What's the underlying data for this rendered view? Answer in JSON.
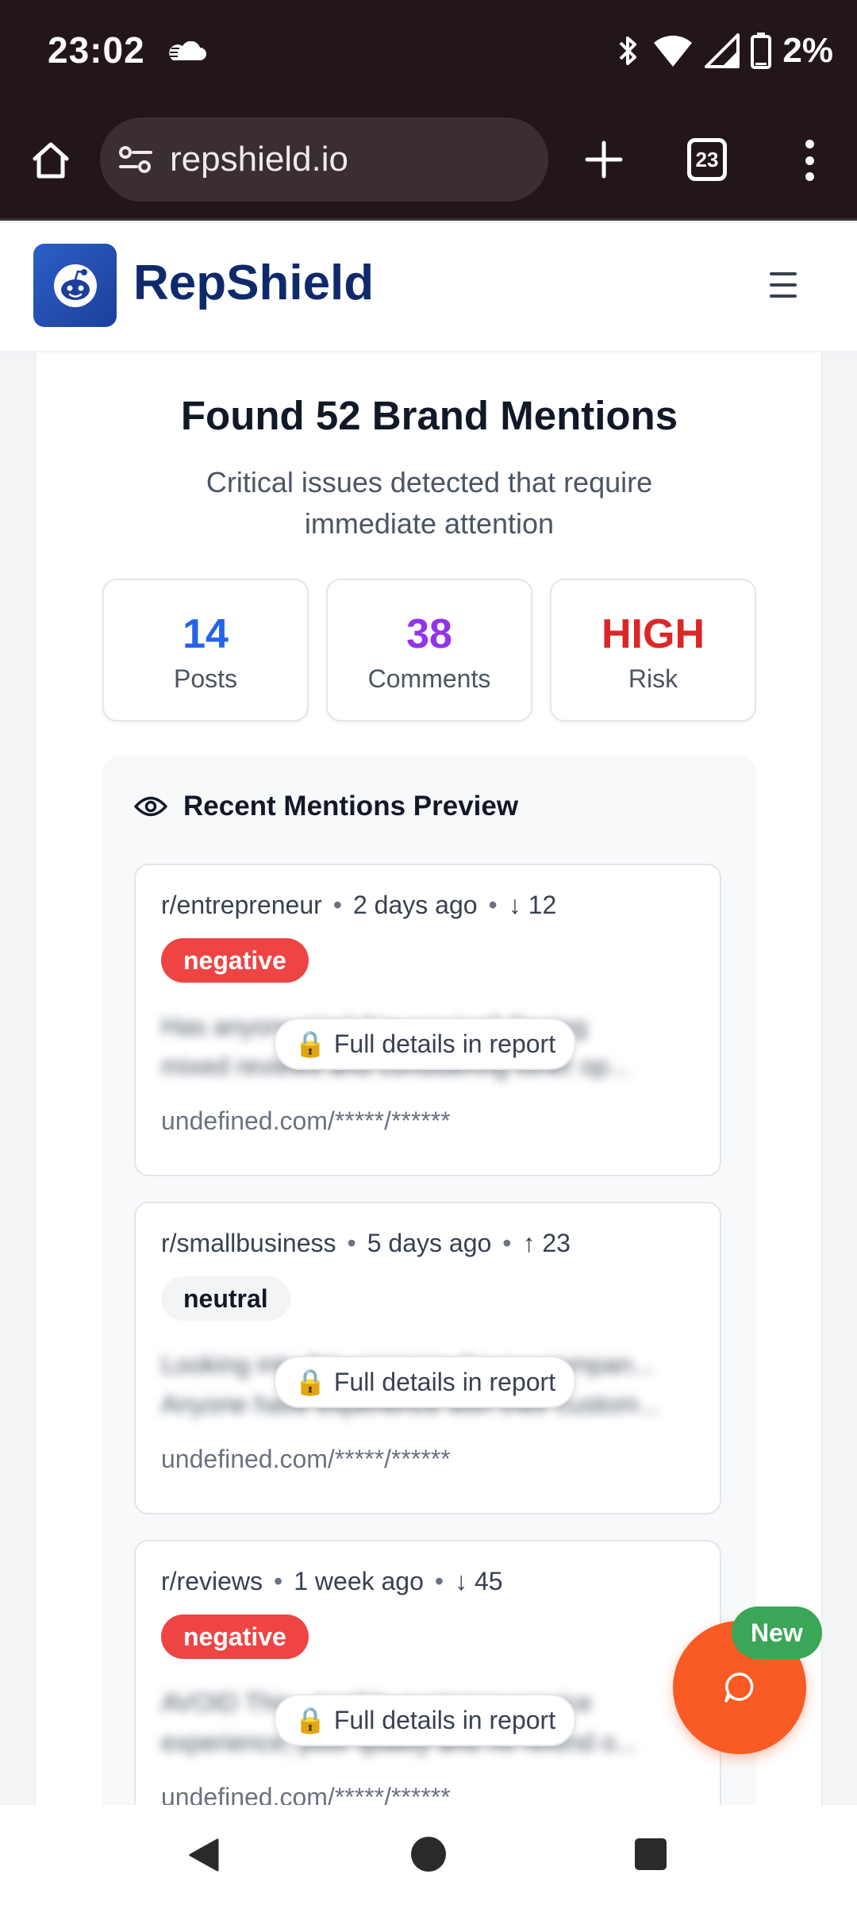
{
  "status_bar": {
    "time": "23:02",
    "battery": "2%",
    "icons": [
      "cloud-icon",
      "bluetooth-icon",
      "wifi-icon",
      "signal-icon",
      "battery-icon"
    ]
  },
  "browser": {
    "url": "repshield.io",
    "tab_count": "23",
    "icons": [
      "home-icon",
      "site-settings-icon",
      "plus-icon",
      "tabs-icon",
      "more-vert-icon"
    ]
  },
  "site": {
    "brand": "RepShield",
    "logo_icon": "reddit-shield-icon",
    "menu_icon": "hamburger-icon"
  },
  "report": {
    "title": "Found 52 Brand Mentions",
    "subtitle": "Critical issues detected that require immediate attention",
    "stats": [
      {
        "value": "14",
        "label": "Posts",
        "color": "#2563eb"
      },
      {
        "value": "38",
        "label": "Comments",
        "color": "#9333ea"
      },
      {
        "value": "HIGH",
        "label": "Risk",
        "color": "#dc2626"
      }
    ]
  },
  "preview": {
    "title": "Recent Mentions Preview",
    "icon": "eye-icon",
    "lock_label": "Full details in report",
    "mentions": [
      {
        "subreddit": "r/entrepreneur",
        "time": "2 days ago",
        "vote_arrow": "↓",
        "votes": "12",
        "sentiment": "negative",
        "snippet_line1": "Has anyone tried this service? Seeing",
        "snippet_line2": "mixed reviews and considering other op...",
        "url": "undefined.com/*****/******"
      },
      {
        "subreddit": "r/smallbusiness",
        "time": "5 days ago",
        "vote_arrow": "↑",
        "votes": "23",
        "sentiment": "neutral",
        "snippet_line1": "Looking into this company for our compan...",
        "snippet_line2": "Anyone have experience with their custom...",
        "url": "undefined.com/*****/******"
      },
      {
        "subreddit": "r/reviews",
        "time": "1 week ago",
        "vote_arrow": "↓",
        "votes": "45",
        "sentiment": "negative",
        "snippet_line1": "AVOID This - terrible customer service",
        "snippet_line2": "experience, poor quality and no refund o...",
        "url": "undefined.com/*****/******"
      }
    ]
  },
  "fab": {
    "badge": "New",
    "icon": "chat-icon",
    "color": "#fa5a24"
  },
  "nav": {
    "icons": [
      "back-icon",
      "home-circle-icon",
      "recents-icon"
    ]
  }
}
